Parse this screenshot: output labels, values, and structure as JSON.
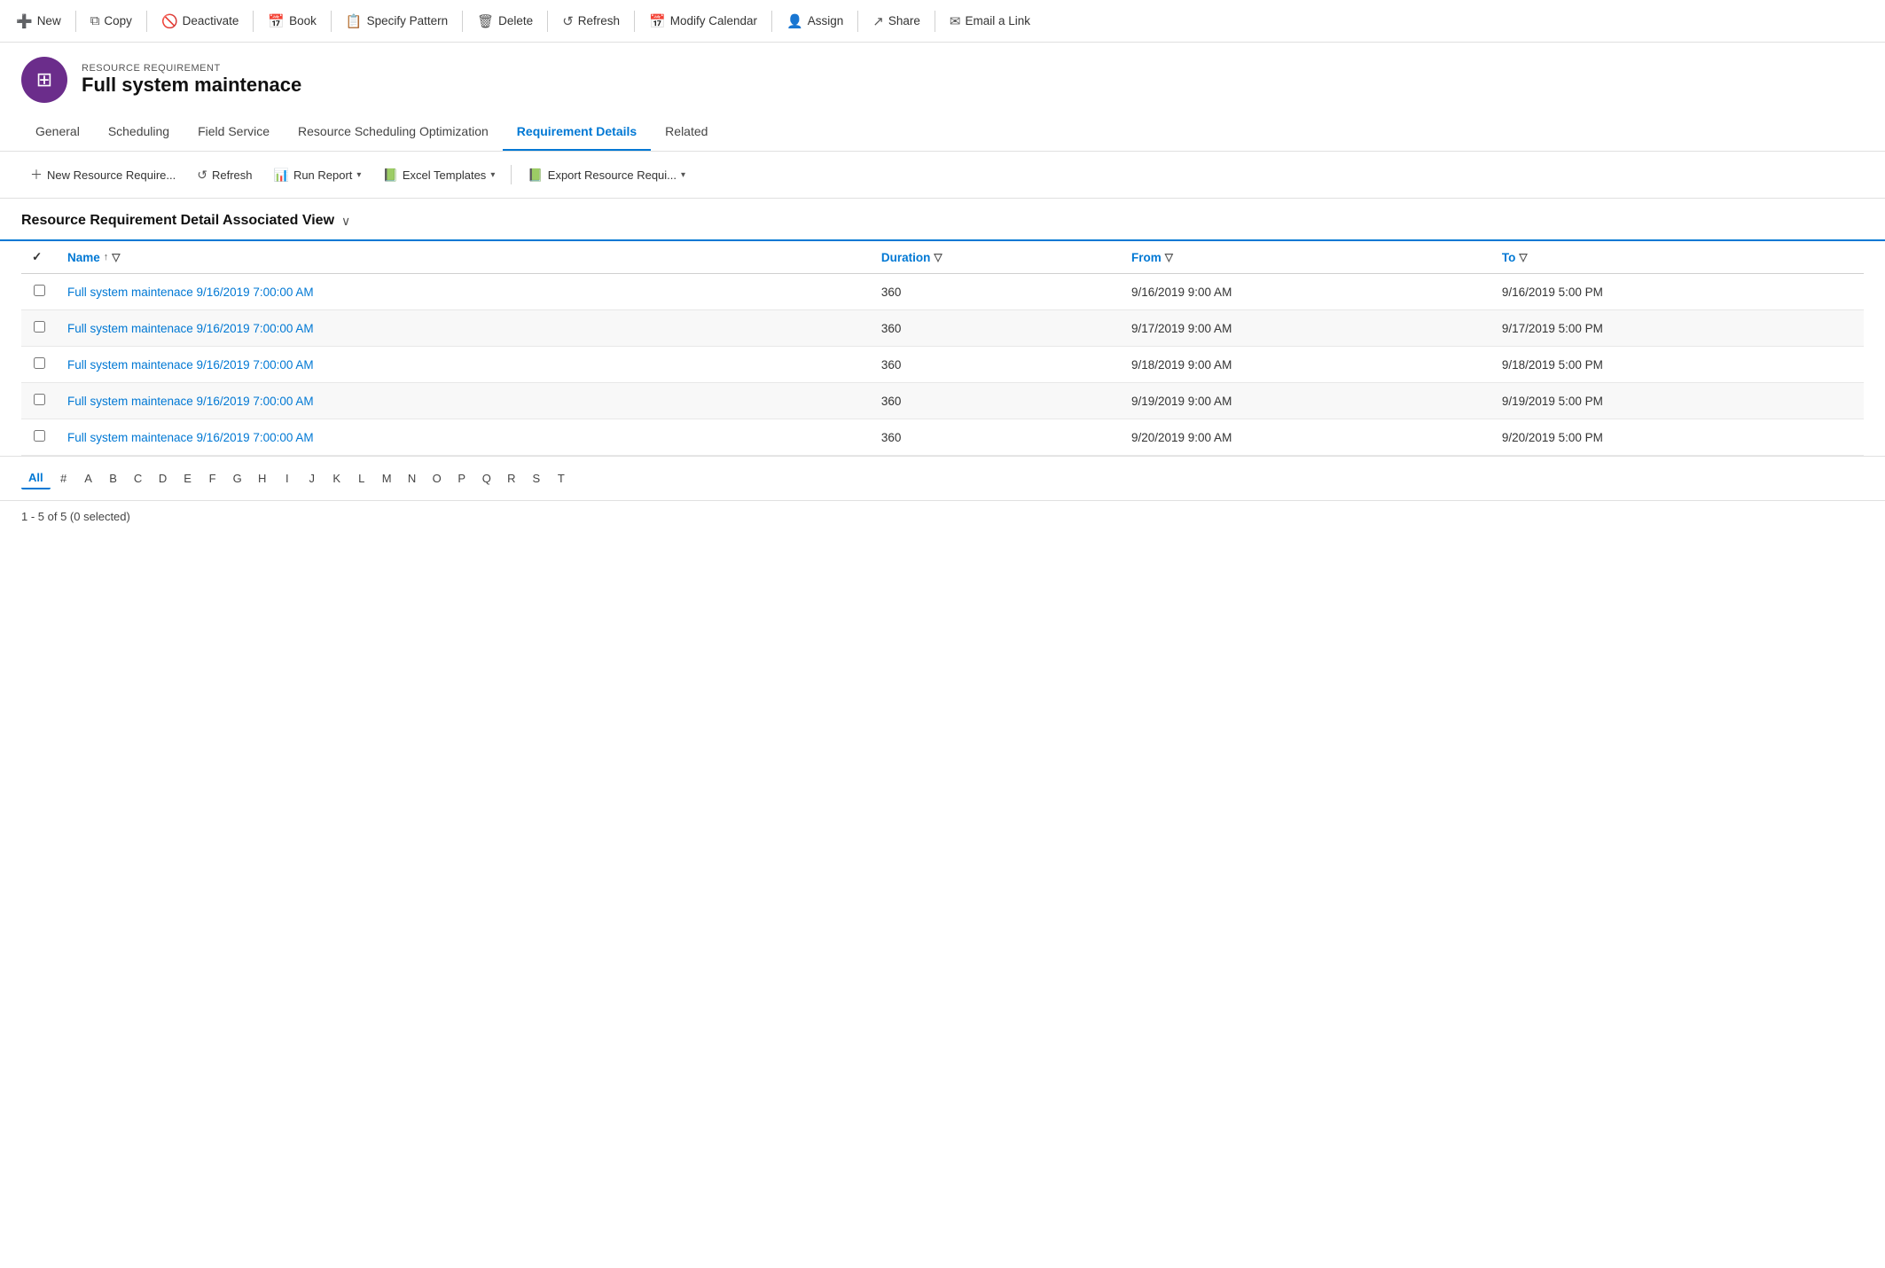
{
  "toolbar": {
    "buttons": [
      {
        "id": "new",
        "label": "New",
        "icon": "➕",
        "iconClass": "new-btn"
      },
      {
        "id": "copy",
        "label": "Copy",
        "icon": "⧉",
        "iconClass": ""
      },
      {
        "id": "deactivate",
        "label": "Deactivate",
        "icon": "🚫",
        "iconClass": "deactivate-btn"
      },
      {
        "id": "book",
        "label": "Book",
        "icon": "📅",
        "iconClass": ""
      },
      {
        "id": "specify-pattern",
        "label": "Specify Pattern",
        "icon": "📋",
        "iconClass": ""
      },
      {
        "id": "delete",
        "label": "Delete",
        "icon": "🗑",
        "iconClass": ""
      },
      {
        "id": "refresh",
        "label": "Refresh",
        "icon": "↺",
        "iconClass": ""
      },
      {
        "id": "modify-calendar",
        "label": "Modify Calendar",
        "icon": "📅",
        "iconClass": ""
      },
      {
        "id": "assign",
        "label": "Assign",
        "icon": "👤",
        "iconClass": ""
      },
      {
        "id": "share",
        "label": "Share",
        "icon": "↗",
        "iconClass": ""
      },
      {
        "id": "email-link",
        "label": "Email a Link",
        "icon": "✉",
        "iconClass": ""
      }
    ]
  },
  "entity": {
    "type_label": "RESOURCE REQUIREMENT",
    "name": "Full system maintenace",
    "icon_symbol": "⊞"
  },
  "tabs": [
    {
      "id": "general",
      "label": "General",
      "active": false
    },
    {
      "id": "scheduling",
      "label": "Scheduling",
      "active": false
    },
    {
      "id": "field-service",
      "label": "Field Service",
      "active": false
    },
    {
      "id": "rso",
      "label": "Resource Scheduling Optimization",
      "active": false
    },
    {
      "id": "requirement-details",
      "label": "Requirement Details",
      "active": true
    },
    {
      "id": "related",
      "label": "Related",
      "active": false
    }
  ],
  "sub_toolbar": {
    "new_label": "New Resource Require...",
    "refresh_label": "Refresh",
    "run_report_label": "Run Report",
    "excel_templates_label": "Excel Templates",
    "export_label": "Export Resource Requi..."
  },
  "view": {
    "title": "Resource Requirement Detail Associated View"
  },
  "table": {
    "columns": [
      {
        "id": "name",
        "label": "Name",
        "sortable": true,
        "filterable": true
      },
      {
        "id": "duration",
        "label": "Duration",
        "sortable": false,
        "filterable": true
      },
      {
        "id": "from",
        "label": "From",
        "sortable": false,
        "filterable": true
      },
      {
        "id": "to",
        "label": "To",
        "sortable": false,
        "filterable": true
      }
    ],
    "rows": [
      {
        "name": "Full system maintenace 9/16/2019 7:00:00 AM",
        "duration": "360",
        "from": "9/16/2019 9:00 AM",
        "to": "9/16/2019 5:00 PM"
      },
      {
        "name": "Full system maintenace 9/16/2019 7:00:00 AM",
        "duration": "360",
        "from": "9/17/2019 9:00 AM",
        "to": "9/17/2019 5:00 PM"
      },
      {
        "name": "Full system maintenace 9/16/2019 7:00:00 AM",
        "duration": "360",
        "from": "9/18/2019 9:00 AM",
        "to": "9/18/2019 5:00 PM"
      },
      {
        "name": "Full system maintenace 9/16/2019 7:00:00 AM",
        "duration": "360",
        "from": "9/19/2019 9:00 AM",
        "to": "9/19/2019 5:00 PM"
      },
      {
        "name": "Full system maintenace 9/16/2019 7:00:00 AM",
        "duration": "360",
        "from": "9/20/2019 9:00 AM",
        "to": "9/20/2019 5:00 PM"
      }
    ]
  },
  "pagination": {
    "letters": [
      "All",
      "#",
      "A",
      "B",
      "C",
      "D",
      "E",
      "F",
      "G",
      "H",
      "I",
      "J",
      "K",
      "L",
      "M",
      "N",
      "O",
      "P",
      "Q",
      "R",
      "S",
      "T"
    ],
    "active": "All"
  },
  "status": {
    "text": "1 - 5 of 5 (0 selected)"
  }
}
